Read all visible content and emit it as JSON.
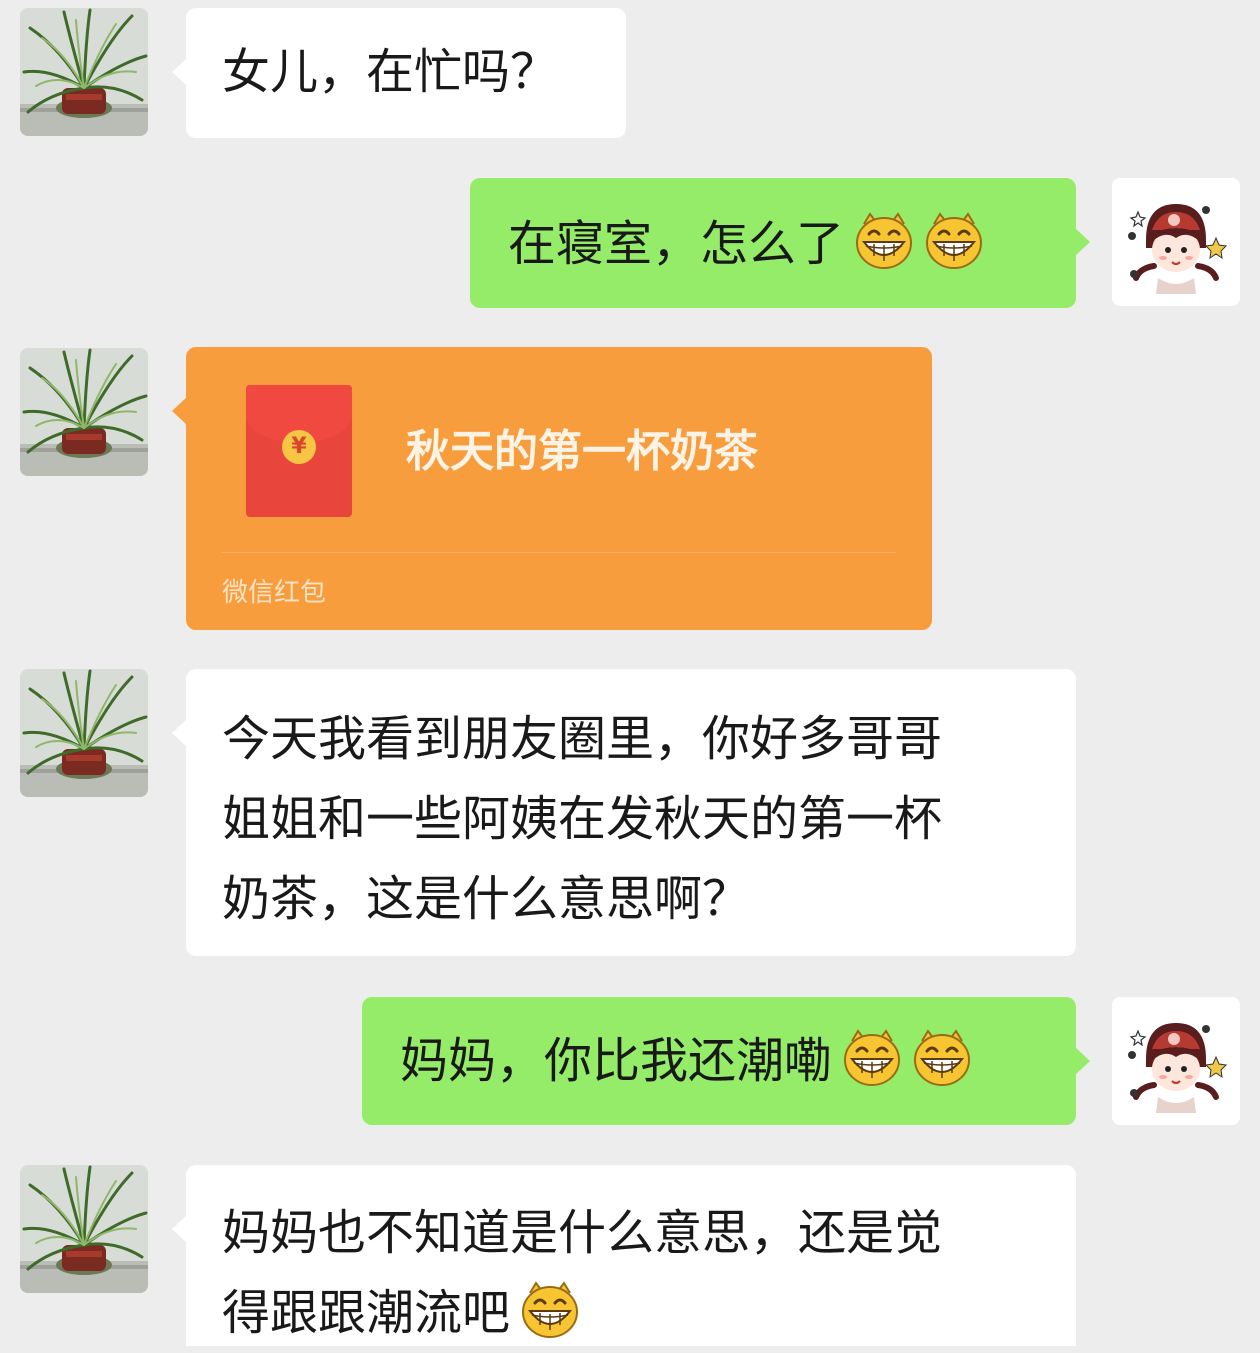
{
  "messages": [
    {
      "type": "text",
      "side": "incoming",
      "text": "女儿，在忙吗？"
    },
    {
      "type": "text",
      "side": "outgoing",
      "text": "在寝室，怎么了",
      "emojis": [
        "grin-emoji",
        "grin-emoji"
      ]
    },
    {
      "type": "red_packet",
      "side": "incoming",
      "title": "秋天的第一杯奶茶",
      "footer": "微信红包",
      "coin_symbol": "¥"
    },
    {
      "type": "text",
      "side": "incoming",
      "lines": [
        "今天我看到朋友圈里，你好多哥哥",
        "姐姐和一些阿姨在发秋天的第一杯",
        "奶茶，这是什么意思啊？"
      ]
    },
    {
      "type": "text",
      "side": "outgoing",
      "text": "妈妈，你比我还潮嘞",
      "emojis": [
        "grin-emoji",
        "grin-emoji"
      ]
    },
    {
      "type": "text",
      "side": "incoming",
      "lines": [
        "妈妈也不知道是什么意思，还是觉",
        "得跟跟潮流吧"
      ],
      "emojis": [
        "grin-emoji"
      ]
    }
  ],
  "colors": {
    "background": "#ededed",
    "incoming_bubble": "#ffffff",
    "outgoing_bubble": "#95ec69",
    "red_packet": "#f79d3d",
    "text": "#191919"
  },
  "avatars": {
    "mom": "plant-avatar",
    "daughter": "cartoon-girl-avatar"
  }
}
